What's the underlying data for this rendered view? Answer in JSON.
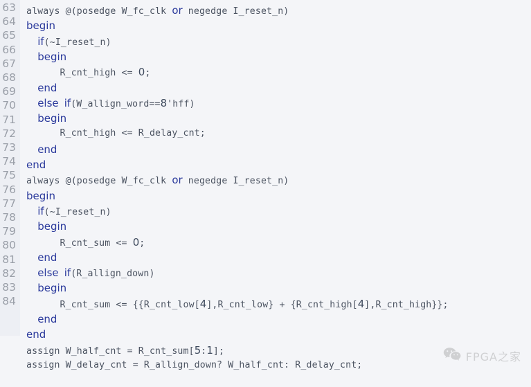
{
  "editor": {
    "background_color": "#f4f5f8",
    "gutter_color": "#edeff4",
    "gutter_text_color": "#9a9fa8",
    "code_color": "#4b5361",
    "keyword_color": "#2b3a9c",
    "number_color": "#3f4b5e",
    "language": "verilog",
    "first_line_number": 63,
    "last_line_number": 84,
    "line_numbers": [
      "63",
      "64",
      "65",
      "66",
      "67",
      "68",
      "69",
      "70",
      "71",
      "72",
      "73",
      "74",
      "75",
      "76",
      "77",
      "78",
      "79",
      "80",
      "81",
      "82",
      "83",
      "84"
    ],
    "lines": [
      {
        "id": "line-1",
        "text": "always @(posedge W_fc_clk or negedge I_reset_n)",
        "tokens": [
          {
            "t": "always @(posedge W_fc_clk ",
            "k": "plain"
          },
          {
            "t": "or",
            "k": "kw"
          },
          {
            "t": " negedge I_reset_n)",
            "k": "plain"
          }
        ]
      },
      {
        "id": "line-2",
        "text": "begin",
        "tokens": [
          {
            "t": "begin",
            "k": "kw"
          }
        ]
      },
      {
        "id": "line-3",
        "text": "  if(~I_reset_n)",
        "tokens": [
          {
            "t": "  ",
            "k": "plain"
          },
          {
            "t": "if",
            "k": "kw"
          },
          {
            "t": "(~I_reset_n)",
            "k": "plain"
          }
        ]
      },
      {
        "id": "line-4",
        "text": "  begin",
        "tokens": [
          {
            "t": "  ",
            "k": "plain"
          },
          {
            "t": "begin",
            "k": "kw"
          }
        ]
      },
      {
        "id": "line-5",
        "text": "      R_cnt_high <= 0;",
        "tokens": [
          {
            "t": "      R_cnt_high <= ",
            "k": "plain"
          },
          {
            "t": "0",
            "k": "num"
          },
          {
            "t": ";",
            "k": "plain"
          }
        ]
      },
      {
        "id": "line-6",
        "text": "  end",
        "tokens": [
          {
            "t": "  ",
            "k": "plain"
          },
          {
            "t": "end",
            "k": "kw"
          }
        ]
      },
      {
        "id": "line-7",
        "text": "  else if(W_allign_word==8'hff)",
        "tokens": [
          {
            "t": "  ",
            "k": "plain"
          },
          {
            "t": "else",
            "k": "kw"
          },
          {
            "t": " ",
            "k": "plain"
          },
          {
            "t": "if",
            "k": "kw"
          },
          {
            "t": "(W_allign_word==",
            "k": "plain"
          },
          {
            "t": "8",
            "k": "num"
          },
          {
            "t": "'hff)",
            "k": "plain"
          }
        ]
      },
      {
        "id": "line-8",
        "text": "  begin",
        "tokens": [
          {
            "t": "  ",
            "k": "plain"
          },
          {
            "t": "begin",
            "k": "kw"
          }
        ]
      },
      {
        "id": "line-9",
        "text": "      R_cnt_high <= R_delay_cnt;",
        "tokens": [
          {
            "t": "      R_cnt_high <= R_delay_cnt;",
            "k": "plain"
          }
        ]
      },
      {
        "id": "line-10",
        "text": "  end",
        "tokens": [
          {
            "t": "  ",
            "k": "plain"
          },
          {
            "t": "end",
            "k": "kw"
          }
        ]
      },
      {
        "id": "line-11",
        "text": "end",
        "tokens": [
          {
            "t": "end",
            "k": "kw"
          }
        ]
      },
      {
        "id": "line-12",
        "text": "always @(posedge W_fc_clk or negedge I_reset_n)",
        "tokens": [
          {
            "t": "always @(posedge W_fc_clk ",
            "k": "plain"
          },
          {
            "t": "or",
            "k": "kw"
          },
          {
            "t": " negedge I_reset_n)",
            "k": "plain"
          }
        ]
      },
      {
        "id": "line-13",
        "text": "begin",
        "tokens": [
          {
            "t": "begin",
            "k": "kw"
          }
        ]
      },
      {
        "id": "line-14",
        "text": "  if(~I_reset_n)",
        "tokens": [
          {
            "t": "  ",
            "k": "plain"
          },
          {
            "t": "if",
            "k": "kw"
          },
          {
            "t": "(~I_reset_n)",
            "k": "plain"
          }
        ]
      },
      {
        "id": "line-15",
        "text": "  begin",
        "tokens": [
          {
            "t": "  ",
            "k": "plain"
          },
          {
            "t": "begin",
            "k": "kw"
          }
        ]
      },
      {
        "id": "line-16",
        "text": "      R_cnt_sum <= 0;",
        "tokens": [
          {
            "t": "      R_cnt_sum <= ",
            "k": "plain"
          },
          {
            "t": "0",
            "k": "num"
          },
          {
            "t": ";",
            "k": "plain"
          }
        ]
      },
      {
        "id": "line-17",
        "text": "  end",
        "tokens": [
          {
            "t": "  ",
            "k": "plain"
          },
          {
            "t": "end",
            "k": "kw"
          }
        ]
      },
      {
        "id": "line-18",
        "text": "  else if(R_allign_down)",
        "tokens": [
          {
            "t": "  ",
            "k": "plain"
          },
          {
            "t": "else",
            "k": "kw"
          },
          {
            "t": " ",
            "k": "plain"
          },
          {
            "t": "if",
            "k": "kw"
          },
          {
            "t": "(R_allign_down)",
            "k": "plain"
          }
        ]
      },
      {
        "id": "line-19",
        "text": "  begin",
        "tokens": [
          {
            "t": "  ",
            "k": "plain"
          },
          {
            "t": "begin",
            "k": "kw"
          }
        ]
      },
      {
        "id": "line-20",
        "text": "      R_cnt_sum <= {{R_cnt_low[4],R_cnt_low} + {R_cnt_high[4],R_cnt_high}};",
        "tokens": [
          {
            "t": "      R_cnt_sum <= {{R_cnt_low[",
            "k": "plain"
          },
          {
            "t": "4",
            "k": "num"
          },
          {
            "t": "],R_cnt_low} + {R_cnt_high[",
            "k": "plain"
          },
          {
            "t": "4",
            "k": "num"
          },
          {
            "t": "],R_cnt_high}};",
            "k": "plain"
          }
        ]
      },
      {
        "id": "line-21",
        "text": "  end",
        "tokens": [
          {
            "t": "  ",
            "k": "plain"
          },
          {
            "t": "end",
            "k": "kw"
          }
        ]
      },
      {
        "id": "line-22",
        "text": "end",
        "tokens": [
          {
            "t": "end",
            "k": "kw"
          }
        ]
      },
      {
        "id": "line-23",
        "text": "assign W_half_cnt = R_cnt_sum[5:1];",
        "tokens": [
          {
            "t": "assign W_half_cnt = R_cnt_sum[",
            "k": "plain"
          },
          {
            "t": "5",
            "k": "num"
          },
          {
            "t": ":",
            "k": "plain"
          },
          {
            "t": "1",
            "k": "num"
          },
          {
            "t": "];",
            "k": "plain"
          }
        ]
      },
      {
        "id": "line-24",
        "text": "assign W_delay_cnt = R_allign_down? W_half_cnt: R_delay_cnt;",
        "tokens": [
          {
            "t": "assign W_delay_cnt = R_allign_down? W_half_cnt: R_delay_cnt;",
            "k": "plain"
          }
        ]
      }
    ]
  },
  "watermark": {
    "icon": "wechat-icon",
    "text": "FPGA之家",
    "color": "#7c7c7c"
  }
}
